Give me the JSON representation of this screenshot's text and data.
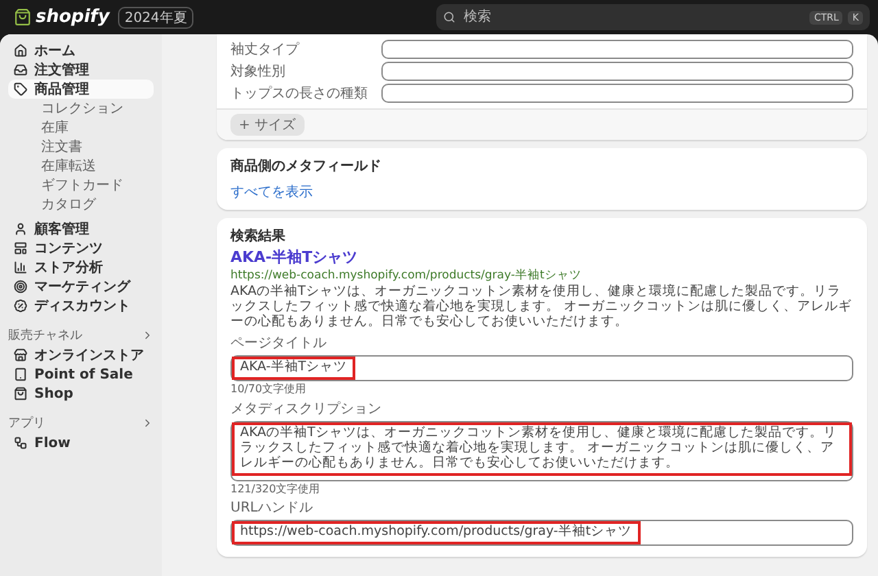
{
  "topbar": {
    "logo": "shopify",
    "badge": "2024年夏",
    "search": {
      "placeholder": "検索",
      "keys": [
        "CTRL",
        "K"
      ]
    }
  },
  "sidebar": {
    "items": [
      {
        "label": "ホーム",
        "selected": false
      },
      {
        "label": "注文管理",
        "selected": false
      },
      {
        "label": "商品管理",
        "selected": true,
        "children": [
          {
            "label": "コレクション"
          },
          {
            "label": "在庫"
          },
          {
            "label": "注文書"
          },
          {
            "label": "在庫転送"
          },
          {
            "label": "ギフトカード"
          },
          {
            "label": "カタログ"
          }
        ]
      },
      {
        "label": "顧客管理",
        "selected": false
      },
      {
        "label": "コンテンツ",
        "selected": false
      },
      {
        "label": "ストア分析",
        "selected": false
      },
      {
        "label": "マーケティング",
        "selected": false
      },
      {
        "label": "ディスカウント",
        "selected": false
      }
    ],
    "sections": [
      {
        "title": "販売チャネル",
        "items": [
          {
            "label": "オンラインストア"
          },
          {
            "label": "Point of Sale"
          },
          {
            "label": "Shop"
          }
        ]
      },
      {
        "title": "アプリ",
        "items": [
          {
            "label": "Flow"
          }
        ]
      }
    ]
  },
  "attributes_card": {
    "rows": [
      {
        "label": "袖丈タイプ"
      },
      {
        "label": "対象性別"
      },
      {
        "label": "トップスの長さの種類"
      }
    ],
    "add_button": "+ サイズ"
  },
  "metafields_card": {
    "title": "商品側のメタフィールド",
    "link": "すべてを表示"
  },
  "seo_card": {
    "title": "検索結果",
    "preview": {
      "title": "AKA-半袖Tシャツ",
      "url": "https://web-coach.myshopify.com/products/gray-半袖tシャツ",
      "description": "AKAの半袖Tシャツは、オーガニックコットン素材を使用し、健康と環境に配慮した製品です。リラックスしたフィット感で快適な着心地を実現します。 オーガニックコットンは肌に優しく、アレルギーの心配もありません。日常でも安心してお使いいただけます。"
    },
    "fields": [
      {
        "kind": "input",
        "label": "ページタイトル",
        "value": "AKA-半袖Tシャツ",
        "counter": "10/70文字使用",
        "highlighted": true
      },
      {
        "kind": "textarea",
        "label": "メタディスクリプション",
        "value": "AKAの半袖Tシャツは、オーガニックコットン素材を使用し、健康と環境に配慮した製品です。リラックスしたフィット感で快適な着心地を実現します。 オーガニックコットンは肌に優しく、アレルギーの心配もありません。日常でも安心してお使いいただけます。",
        "counter": "121/320文字使用",
        "highlighted": true
      },
      {
        "kind": "input",
        "label": "URLハンドル",
        "value": "https://web-coach.myshopify.com/products/gray-半袖tシャツ",
        "highlighted": true
      }
    ]
  }
}
